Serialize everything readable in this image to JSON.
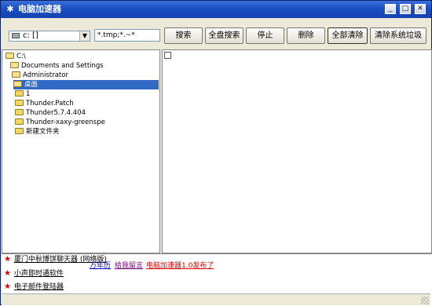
{
  "window": {
    "title": "电脑加速器",
    "app_icon": "app-icon",
    "controls": {
      "minimize": "_",
      "maximize": "□",
      "close": "✕"
    }
  },
  "toolbar": {
    "drive_select_value": "c: []",
    "filter_value": "*.tmp;*.~*",
    "buttons": {
      "search": "搜索",
      "full_disk_search": "全盘搜索",
      "stop": "停止",
      "delete": "删除",
      "delete_all": "全部清除",
      "clean_junk": "清除系统垃圾"
    }
  },
  "tree": {
    "items": [
      {
        "label": "C:\\",
        "depth": 0,
        "open": true
      },
      {
        "label": "Documents and Settings",
        "depth": 1,
        "open": true
      },
      {
        "label": "Administrator",
        "depth": 2,
        "open": true
      },
      {
        "label": "桌面",
        "depth": 3,
        "open": true,
        "selected": true
      },
      {
        "label": "1",
        "depth": 4
      },
      {
        "label": "Thunder.Patch",
        "depth": 4
      },
      {
        "label": "Thunder5.7.4.404",
        "depth": 4
      },
      {
        "label": "Thunder-xaxy-greenspe",
        "depth": 4
      },
      {
        "label": "新建文件夹",
        "depth": 4
      }
    ]
  },
  "bottom_links": {
    "items": [
      {
        "label": "厦门中秋博饼聊天器 (网络版)"
      },
      {
        "label": "小声即时通软件"
      },
      {
        "label": "电子邮件登陆器"
      }
    ],
    "inline": {
      "calendar": "万年历",
      "guestbook": "给我留言",
      "release": "电脑加速器1.0发布了"
    }
  },
  "colors": {
    "title_bar": "#1c4fc4",
    "selection": "#316ac5",
    "star": "#e00000",
    "link_blue": "#0000cc",
    "link_purple": "#800080",
    "link_red": "#e00000"
  }
}
